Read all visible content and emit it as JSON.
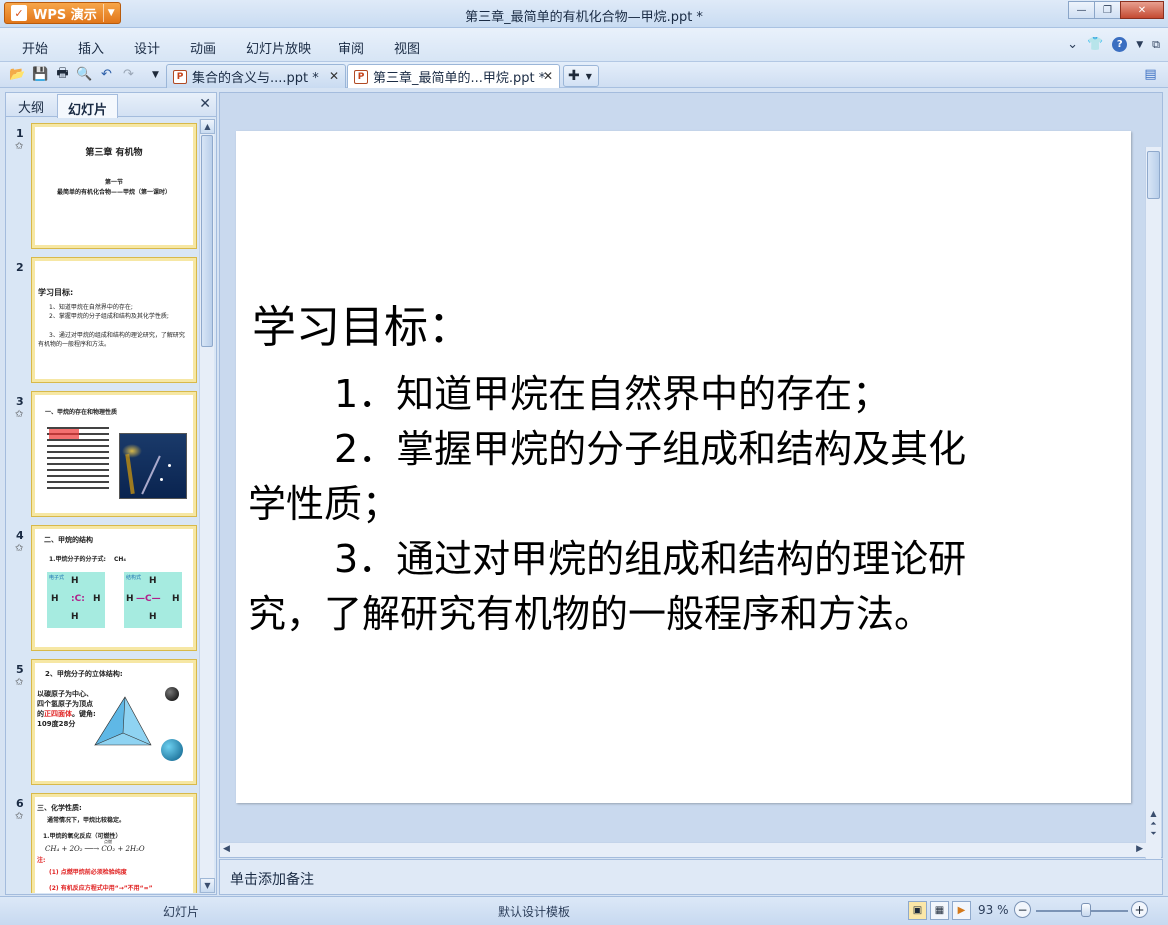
{
  "window": {
    "app_button": "WPS 演示",
    "title": "第三章_最简单的有机化合物—甲烷.ppt *"
  },
  "menu": [
    "开始",
    "插入",
    "设计",
    "动画",
    "幻灯片放映",
    "审阅",
    "视图"
  ],
  "tabs": [
    {
      "label": "集合的含义与....ppt *"
    },
    {
      "label": "第三章_最简单的...甲烷.ppt *"
    }
  ],
  "left_panel": {
    "tabs": [
      "大纲",
      "幻灯片"
    ]
  },
  "thumbnails": [
    {
      "num": "1",
      "title": "第三章 有机物",
      "l1": "第一节",
      "l2": "最简单的有机化合物——甲烷（第一课时）"
    },
    {
      "num": "2",
      "title": "学习目标:",
      "l1": "1、知道甲烷在自然界中的存在;",
      "l2": "2、掌握甲烷的分子组成和结构及其化学性质;",
      "l3": "3、通过对甲烷的组成和结构的理论研究，了解研究有机物的一般程序和方法。"
    },
    {
      "num": "3",
      "title": "一、甲烷的存在和物理性质"
    },
    {
      "num": "4",
      "title": "二、甲烷的结构",
      "l1": "1.甲烷分子的分子式:",
      "l1b": "CH₄",
      "lbl_a": "电子式",
      "lbl_b": "结构式"
    },
    {
      "num": "5",
      "title": "2、甲烷分子的立体结构:",
      "l1": "以碳原子为中心、四个氢原子为顶点的",
      "l1r": "正四面体",
      "l2": "。键角: 109度28分"
    },
    {
      "num": "6",
      "title": "三、化学性质:",
      "l1": "通常情况下，甲烷比较稳定。",
      "l2": "1.甲烷的氧化反应（可燃性）",
      "l3": "CH₄ + 2O₂ ──→ CO₂ + 2H₂O",
      "l3a": "点燃",
      "l4": "注:",
      "l5": "(1) 点燃甲烷前必须检验纯度",
      "l6": "(2) 有机反应方程式中用“→”不用“=”"
    }
  ],
  "slide": {
    "title": "学习目标：",
    "item1": "1．知道甲烷在自然界中的存在；",
    "item2a": "2．掌握甲烷的分子组成和结构及其化",
    "item2b": "学性质；",
    "item3a": "3．通过对甲烷的组成和结构的理论研",
    "item3b": "究，了解研究有机物的一般程序和方法。"
  },
  "notes_placeholder": "单击添加备注",
  "status": {
    "left": "幻灯片",
    "template": "默认设计模板",
    "zoom": "93 %",
    "zoom_level_percent": 93
  }
}
